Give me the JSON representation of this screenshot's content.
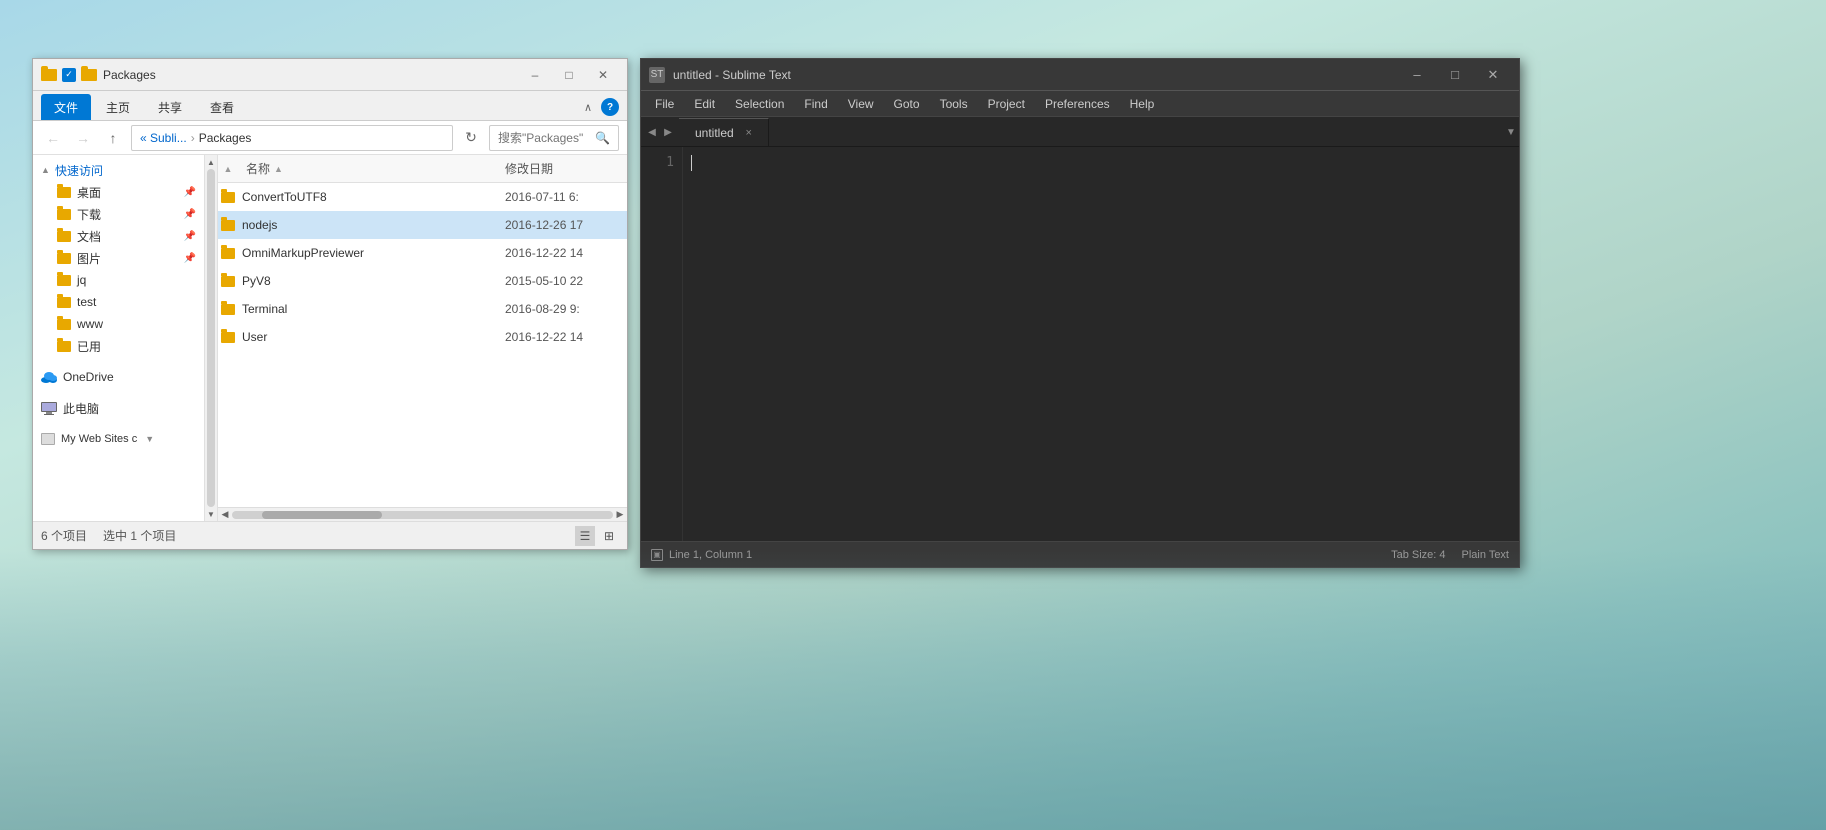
{
  "explorer": {
    "title": "Packages",
    "titlebar": {
      "title": "Packages",
      "minimize": "–",
      "maximize": "□",
      "close": "✕"
    },
    "ribbon": {
      "tabs": [
        "文件",
        "主页",
        "共享",
        "查看"
      ]
    },
    "address": {
      "back": "←",
      "forward": "→",
      "up": "↑",
      "path_parts": [
        "« Subli...",
        "Packages"
      ],
      "search_placeholder": "搜索\"Packages\""
    },
    "sidebar": {
      "quick_access_label": "快速访问",
      "items": [
        {
          "name": "桌面",
          "pinned": true
        },
        {
          "name": "下载",
          "pinned": true
        },
        {
          "name": "文档",
          "pinned": true
        },
        {
          "name": "图片",
          "pinned": true
        },
        {
          "name": "jq"
        },
        {
          "name": "test"
        },
        {
          "name": "www"
        },
        {
          "name": "已用"
        }
      ],
      "onedrive_label": "OneDrive",
      "pc_label": "此电脑",
      "webpage_label": "My Web Sites c"
    },
    "columns": {
      "name": "名称",
      "date": "修改日期"
    },
    "files": [
      {
        "name": "ConvertToUTF8",
        "date": "2016-07-11 6:",
        "selected": false
      },
      {
        "name": "nodejs",
        "date": "2016-12-26 17",
        "selected": true
      },
      {
        "name": "OmniMarkupPreviewer",
        "date": "2016-12-22 14",
        "selected": false
      },
      {
        "name": "PyV8",
        "date": "2015-05-10 22",
        "selected": false
      },
      {
        "name": "Terminal",
        "date": "2016-08-29 9:",
        "selected": false
      },
      {
        "name": "User",
        "date": "2016-12-22 14",
        "selected": false
      }
    ],
    "statusbar": {
      "count": "6 个项目",
      "selected": "选中 1 个项目"
    }
  },
  "sublime": {
    "title": "untitled - Sublime Text",
    "title_icon": "ST",
    "titlebar": {
      "minimize": "–",
      "maximize": "□",
      "close": "✕"
    },
    "menu": {
      "items": [
        "File",
        "Edit",
        "Selection",
        "Find",
        "View",
        "Goto",
        "Tools",
        "Project",
        "Preferences",
        "Help"
      ]
    },
    "tab": {
      "name": "untitled",
      "close": "×"
    },
    "editor": {
      "line_numbers": [
        "1"
      ],
      "cursor_visible": true
    },
    "statusbar": {
      "icon": "▣",
      "position": "Line 1, Column 1",
      "tab_size": "Tab Size: 4",
      "syntax": "Plain Text"
    }
  }
}
